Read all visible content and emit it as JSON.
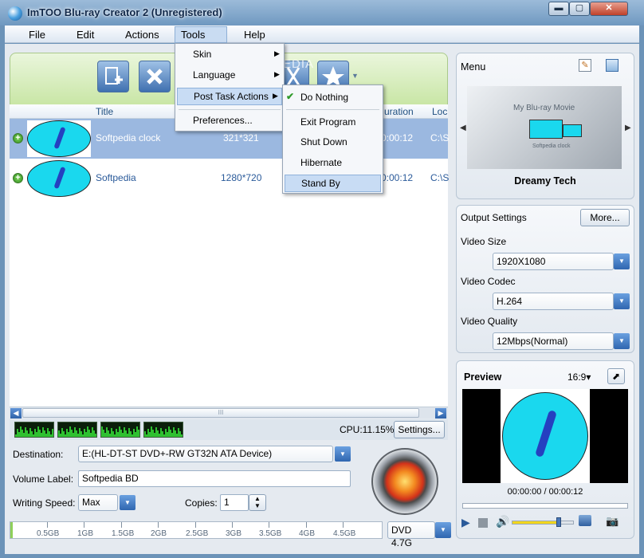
{
  "window": {
    "title": "ImTOO Blu-ray Creator 2 (Unregistered)",
    "minimize": "▬",
    "maximize": "▢",
    "close": "✕"
  },
  "menubar": [
    "File",
    "Edit",
    "Actions",
    "Tools",
    "Help"
  ],
  "tools_menu": {
    "items": [
      "Skin",
      "Language",
      "Post Task Actions",
      "Preferences..."
    ]
  },
  "post_task_menu": {
    "items": [
      "Do Nothing",
      "Exit Program",
      "Shut Down",
      "Hibernate",
      "Stand By"
    ],
    "checked": "Do Nothing",
    "highlighted": "Stand By"
  },
  "watermark": "SOFTPEDIA",
  "file_list": {
    "headers": [
      "Title",
      "uration",
      "Loc"
    ],
    "rows": [
      {
        "title": "Softpedia clock",
        "size": "321*321",
        "duration": "0:00:12",
        "location": "C:\\S",
        "selected": true
      },
      {
        "title": "Softpedia",
        "size": "1280*720",
        "duration": "0:00:12",
        "location": "C:\\S",
        "selected": false
      }
    ]
  },
  "scroll_grip": "III",
  "cpu": {
    "label": "CPU:11.15%",
    "settings_button": "Settings..."
  },
  "destination": {
    "label": "Destination:",
    "value": "E:(HL-DT-ST DVD+-RW GT32N ATA Device)"
  },
  "volume_label": {
    "label": "Volume Label:",
    "value": "Softpedia BD"
  },
  "writing_speed": {
    "label": "Writing Speed:",
    "value": "Max"
  },
  "copies": {
    "label": "Copies:",
    "value": "1"
  },
  "capacity_ruler": [
    "0.5GB",
    "1GB",
    "1.5GB",
    "2GB",
    "2.5GB",
    "3GB",
    "3.5GB",
    "4GB",
    "4.5GB"
  ],
  "disc_type": "DVD 4.7G",
  "menu_panel": {
    "label": "Menu",
    "theme_name": "Dreamy Tech",
    "preview_title": "My Blu-ray Movie",
    "preview_caption": "Softpedia clock"
  },
  "output_settings": {
    "label": "Output Settings",
    "more_button": "More...",
    "video_size": {
      "label": "Video Size",
      "value": "1920X1080"
    },
    "video_codec": {
      "label": "Video Codec",
      "value": "H.264"
    },
    "video_quality": {
      "label": "Video Quality",
      "value": "12Mbps(Normal)"
    }
  },
  "preview": {
    "label": "Preview",
    "aspect": "16:9▾",
    "time": "00:00:00 / 00:00:12",
    "volume_level": 0.75
  },
  "colors": {
    "accent": "#2f66b0",
    "selection": "#9bb8e0",
    "toolbar_green": "#c9e6a6"
  }
}
